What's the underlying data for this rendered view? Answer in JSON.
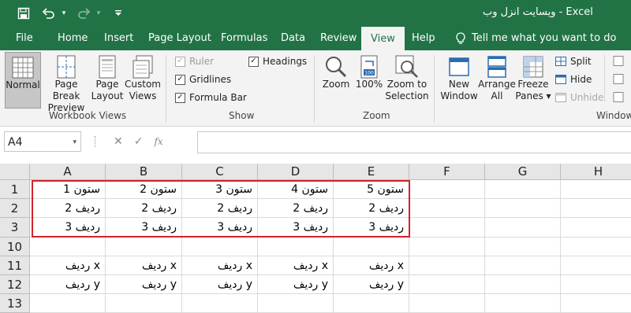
{
  "window": {
    "title": "ویسایت انزل وب  -  Excel"
  },
  "qat": {
    "save_icon": "save-icon",
    "undo_icon": "undo-icon",
    "redo_icon": "redo-icon",
    "customize_icon": "customize-qat-icon"
  },
  "menu": {
    "file": "File",
    "home": "Home",
    "insert": "Insert",
    "page_layout": "Page Layout",
    "formulas": "Formulas",
    "data": "Data",
    "review": "Review",
    "view": "View",
    "help": "Help",
    "tell_me": "Tell me what you want to do"
  },
  "ribbon": {
    "workbook_views": {
      "label": "Workbook Views",
      "normal": "Normal",
      "page_break_1": "Page Break",
      "page_break_2": "Preview",
      "page_layout_1": "Page",
      "page_layout_2": "Layout",
      "custom_1": "Custom",
      "custom_2": "Views"
    },
    "show": {
      "label": "Show",
      "ruler": "Ruler",
      "gridlines": "Gridlines",
      "formula_bar": "Formula Bar",
      "headings": "Headings"
    },
    "zoom": {
      "label": "Zoom",
      "zoom": "Zoom",
      "hundred": "100%",
      "zoom_sel_1": "Zoom to",
      "zoom_sel_2": "Selection"
    },
    "window": {
      "label": "Window",
      "new_1": "New",
      "new_2": "Window",
      "arrange_1": "Arrange",
      "arrange_2": "All",
      "freeze_1": "Freeze",
      "freeze_2": "Panes ▾",
      "split": "Split",
      "hide": "Hide",
      "unhide": "Unhide"
    }
  },
  "formula_bar": {
    "name_box": "A4",
    "fx": "fx",
    "formula": ""
  },
  "grid": {
    "columns": [
      "A",
      "B",
      "C",
      "D",
      "E",
      "F",
      "G",
      "H"
    ],
    "rows": [
      {
        "num": "1",
        "cells": [
          "ستون 1",
          "ستون 2",
          "ستون 3",
          "ستون 4",
          "ستون 5",
          "",
          "",
          ""
        ]
      },
      {
        "num": "2",
        "cells": [
          "ردیف 2",
          "ردیف 2",
          "ردیف 2",
          "ردیف 2",
          "ردیف 2",
          "",
          "",
          ""
        ]
      },
      {
        "num": "3",
        "cells": [
          "ردیف 3",
          "ردیف 3",
          "ردیف 3",
          "ردیف 3",
          "ردیف 3",
          "",
          "",
          ""
        ]
      },
      {
        "num": "10",
        "cells": [
          "",
          "",
          "",
          "",
          "",
          "",
          "",
          ""
        ]
      },
      {
        "num": "11",
        "cells": [
          "ردیف x",
          "ردیف x",
          "ردیف x",
          "ردیف x",
          "ردیف x",
          "",
          "",
          ""
        ]
      },
      {
        "num": "12",
        "cells": [
          "ردیف y",
          "ردیف y",
          "ردیف y",
          "ردیف y",
          "ردیف y",
          "",
          "",
          ""
        ]
      },
      {
        "num": "13",
        "cells": [
          "",
          "",
          "",
          "",
          "",
          "",
          "",
          ""
        ]
      }
    ],
    "highlight_color": "#d0242b"
  },
  "colors": {
    "brand": "#217346",
    "ribbon_bg": "#f3f3f3"
  }
}
